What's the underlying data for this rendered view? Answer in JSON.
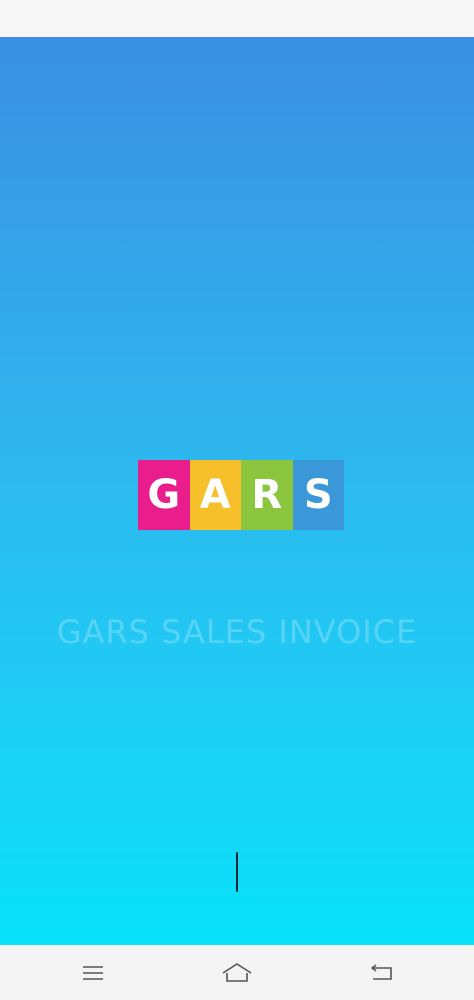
{
  "logo": {
    "letters": [
      {
        "char": "G",
        "color": "#e91e8c"
      },
      {
        "char": "A",
        "color": "#f7c02a"
      },
      {
        "char": "R",
        "color": "#8cc63f"
      },
      {
        "char": "S",
        "color": "#3a97d8"
      }
    ]
  },
  "splash": {
    "app_name": "GARS SALES INVOICE",
    "gradient_top": "#3a8fe4",
    "gradient_bottom": "#07e2fb"
  },
  "nav": {
    "menu_icon": "menu-lines-icon",
    "home_icon": "home-icon",
    "back_icon": "back-icon"
  }
}
